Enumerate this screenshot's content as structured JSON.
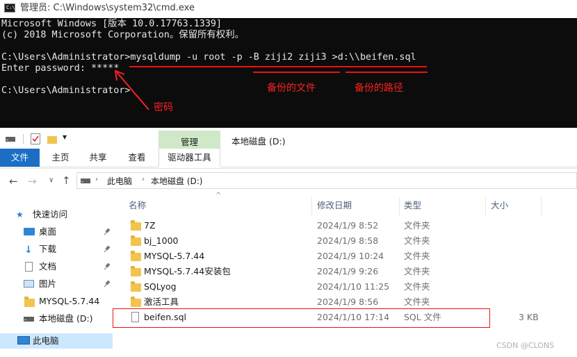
{
  "cmd": {
    "title": "管理员: C:\\Windows\\system32\\cmd.exe",
    "icon_text": "C:\\",
    "lines": [
      "Microsoft Windows [版本 10.0.17763.1339]",
      "(c) 2018 Microsoft Corporation。保留所有权利。",
      "",
      "C:\\Users\\Administrator>mysqldump -u root -p -B ziji2 ziji3 >d:\\\\beifen.sql",
      "Enter password: *****",
      "",
      "C:\\Users\\Administrator>"
    ],
    "annotations": {
      "backup_files": "备份的文件",
      "backup_path": "备份的路径",
      "password": "密码"
    },
    "annotation_color": "#e11111"
  },
  "explorer": {
    "quick_access_toolbar": {
      "dropdown_symbol": "▾"
    },
    "context_tab_group": "管理",
    "context_tab_group_color": "#cfe8c7",
    "location_title": "本地磁盘 (D:)",
    "tabs": [
      {
        "label": "文件",
        "active": true
      },
      {
        "label": "主页"
      },
      {
        "label": "共享"
      },
      {
        "label": "查看"
      },
      {
        "label": "驱动器工具"
      }
    ],
    "accent_color": "#1a6fc4",
    "breadcrumb": [
      "此电脑",
      "本地磁盘 (D:)"
    ],
    "nav_pane": [
      {
        "label": "快速访问",
        "icon": "star-icon",
        "pinned": false
      },
      {
        "label": "桌面",
        "icon": "desktop-icon",
        "pinned": true
      },
      {
        "label": "下载",
        "icon": "download-icon",
        "pinned": true
      },
      {
        "label": "文档",
        "icon": "document-icon",
        "pinned": true
      },
      {
        "label": "图片",
        "icon": "picture-icon",
        "pinned": true
      },
      {
        "label": "MYSQL-5.7.44",
        "icon": "folder-icon",
        "pinned": false
      },
      {
        "label": "本地磁盘 (D:)",
        "icon": "drive-icon",
        "pinned": false
      },
      {
        "label": "此电脑",
        "icon": "pc-icon",
        "pinned": false
      }
    ],
    "columns": {
      "name": "名称",
      "modified": "修改日期",
      "type": "类型",
      "size": "大小"
    },
    "files": [
      {
        "name": "7Z",
        "modified": "2024/1/9 8:52",
        "type": "文件夹",
        "size": "",
        "icon": "folder-icon"
      },
      {
        "name": "bj_1000",
        "modified": "2024/1/9 8:58",
        "type": "文件夹",
        "size": "",
        "icon": "folder-icon"
      },
      {
        "name": "MYSQL-5.7.44",
        "modified": "2024/1/9 10:24",
        "type": "文件夹",
        "size": "",
        "icon": "folder-icon"
      },
      {
        "name": "MYSQL-5.7.44安装包",
        "modified": "2024/1/9 9:26",
        "type": "文件夹",
        "size": "",
        "icon": "folder-icon"
      },
      {
        "name": "SQLyog",
        "modified": "2024/1/10 11:25",
        "type": "文件夹",
        "size": "",
        "icon": "folder-icon"
      },
      {
        "name": "激活工具",
        "modified": "2024/1/9 8:56",
        "type": "文件夹",
        "size": "",
        "icon": "folder-icon"
      },
      {
        "name": "beifen.sql",
        "modified": "2024/1/10 17:14",
        "type": "SQL 文件",
        "size": "3 KB",
        "icon": "file-icon",
        "highlighted": true
      }
    ],
    "watermark": "CSDN @CLONS"
  }
}
